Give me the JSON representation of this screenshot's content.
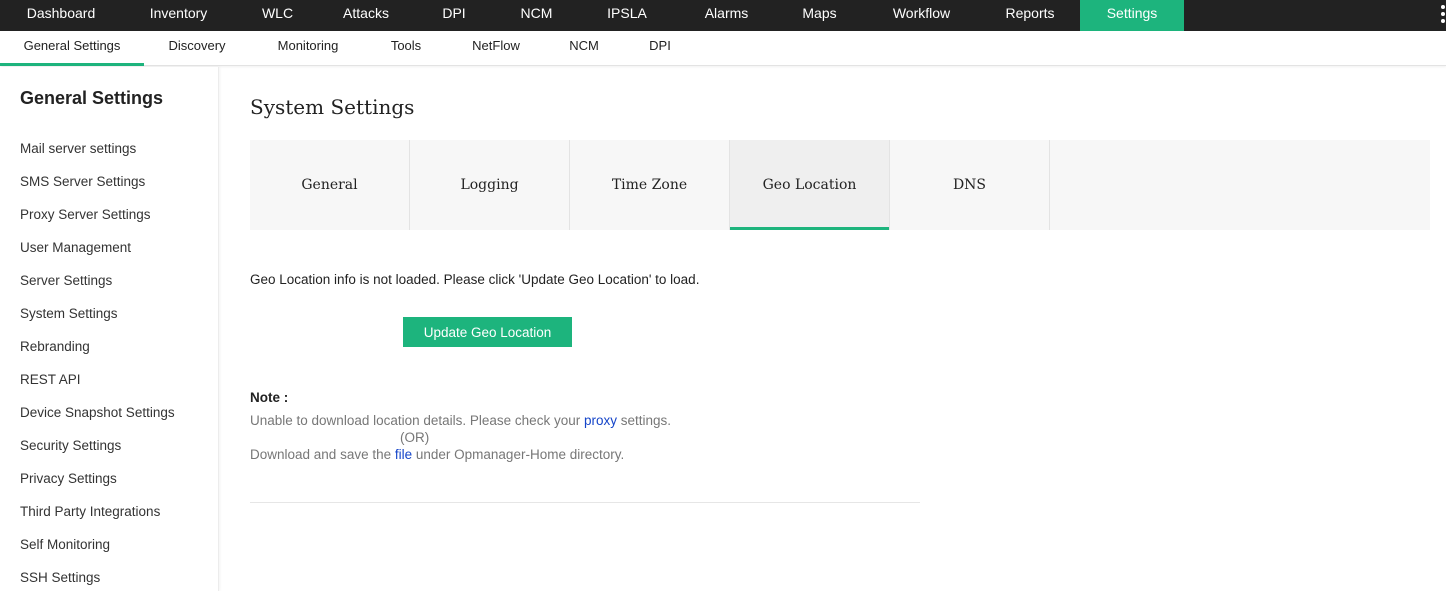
{
  "top_nav": {
    "items": [
      "Dashboard",
      "Inventory",
      "WLC",
      "Attacks",
      "DPI",
      "NCM",
      "IPSLA",
      "Alarms",
      "Maps",
      "Workflow",
      "Reports",
      "Settings"
    ],
    "active": "Settings"
  },
  "sub_nav": {
    "items": [
      "General Settings",
      "Discovery",
      "Monitoring",
      "Tools",
      "NetFlow",
      "NCM",
      "DPI"
    ],
    "active": "General Settings"
  },
  "sidebar": {
    "title": "General Settings",
    "items": [
      "Mail server settings",
      "SMS Server Settings",
      "Proxy Server Settings",
      "User Management",
      "Server Settings",
      "System Settings",
      "Rebranding",
      "REST API",
      "Device Snapshot Settings",
      "Security Settings",
      "Privacy Settings",
      "Third Party Integrations",
      "Self Monitoring",
      "SSH Settings"
    ]
  },
  "main": {
    "title": "System Settings",
    "tabs": [
      "General",
      "Logging",
      "Time Zone",
      "Geo Location",
      "DNS"
    ],
    "active_tab": "Geo Location",
    "info_text": "Geo Location info is not loaded. Please click 'Update Geo Location' to load.",
    "update_button": "Update Geo Location",
    "note": {
      "label": "Note :",
      "line1_prefix": "Unable to download location details. Please check your ",
      "line1_link": "proxy",
      "line1_suffix": " settings.",
      "or": "(OR)",
      "line2_prefix": "Download and save the ",
      "line2_link": "file",
      "line2_suffix": " under Opmanager-Home directory."
    }
  },
  "colors": {
    "accent": "#1db47d",
    "top_nav_bg": "#222222",
    "link": "#1545c9"
  }
}
